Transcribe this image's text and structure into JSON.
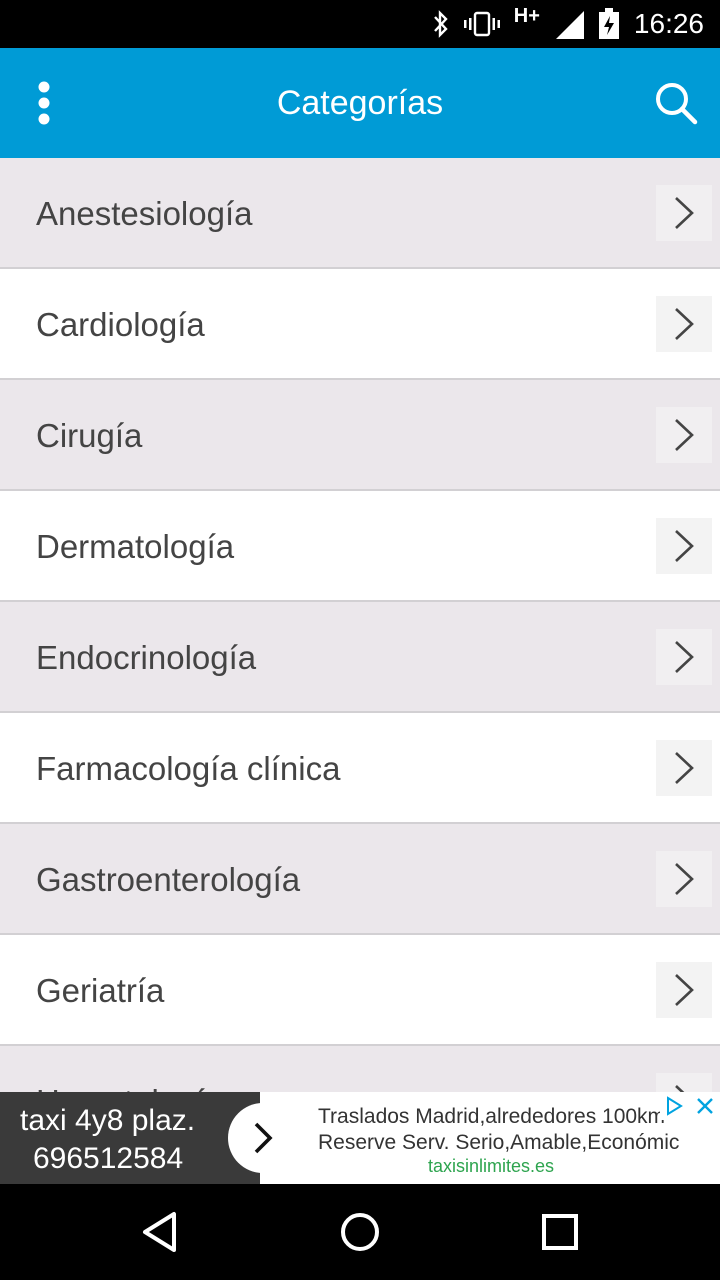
{
  "status_bar": {
    "time": "16:26",
    "network": "H+",
    "icons": [
      "bluetooth-icon",
      "vibrate-icon",
      "network-type-icon",
      "signal-icon",
      "battery-icon"
    ]
  },
  "app_bar": {
    "title": "Categorías",
    "menu_icon": "overflow-menu-icon",
    "search_icon": "search-icon",
    "color": "#009bd6"
  },
  "categories": [
    {
      "label": "Anestesiología"
    },
    {
      "label": "Cardiología"
    },
    {
      "label": "Cirugía"
    },
    {
      "label": "Dermatología"
    },
    {
      "label": "Endocrinología"
    },
    {
      "label": "Farmacología clínica"
    },
    {
      "label": "Gastroenterología"
    },
    {
      "label": "Geriatría"
    },
    {
      "label": "Hematología"
    }
  ],
  "ad": {
    "left_line1": "taxi 4y8 plaz.",
    "left_line2": "696512584",
    "text_line1": "Traslados Madrid,alrededores 100km",
    "text_line2": "Reserve Serv. Serio,Amable,Económic",
    "url": "taxisinlimites.es"
  },
  "nav_bar": {
    "buttons": [
      "back-icon",
      "home-icon",
      "recents-icon"
    ]
  }
}
